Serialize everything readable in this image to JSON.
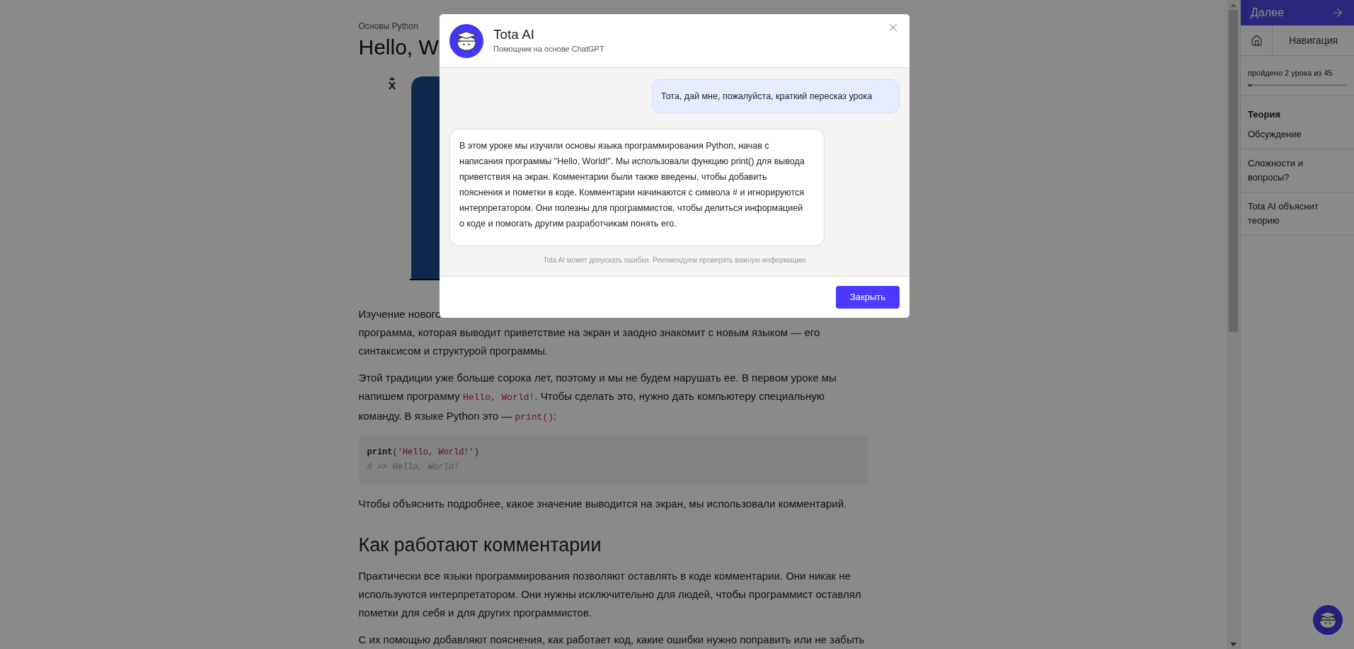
{
  "article": {
    "breadcrumb": "Основы Python",
    "title": "Hello, W",
    "blocks": [
      {
        "kind": "paragraph",
        "parts": [
          {
            "kind": "text",
            "text": "Изучение нового"
          }
        ],
        "continued": [
          {
            "kind": "text",
            "text": "программа, которая выводит приветствие на экран и заодно знакомит с новым языком — его синтаксисом и структурой программы."
          }
        ]
      },
      {
        "kind": "paragraph",
        "parts": [
          {
            "kind": "text",
            "text": "Этой традиции уже больше сорока лет, поэтому и мы не будем нарушать ее. В первом уроке мы напишем программу "
          },
          {
            "kind": "code",
            "text": "Hello, World!"
          },
          {
            "kind": "text",
            "text": ". Чтобы сделать это, нужно дать компьютеру специальную команду. В языке Python это — "
          },
          {
            "kind": "code",
            "text": "print()"
          },
          {
            "kind": "text",
            "text": ":"
          }
        ]
      },
      {
        "kind": "code_block",
        "lines": [
          [
            {
              "kind": "function",
              "text": "print"
            },
            {
              "kind": "punct",
              "text": "("
            },
            {
              "kind": "string",
              "text": "'Hello, World!'"
            },
            {
              "kind": "punct",
              "text": ")"
            }
          ],
          [
            {
              "kind": "comment",
              "text": "# => Hello, World!"
            }
          ]
        ]
      },
      {
        "kind": "paragraph",
        "parts": [
          {
            "kind": "text",
            "text": "Чтобы объяснить подробнее, какое значение выводится на экран, мы использовали комментарий."
          }
        ]
      },
      {
        "kind": "heading",
        "text": "Как работают комментарии"
      },
      {
        "kind": "paragraph",
        "parts": [
          {
            "kind": "text",
            "text": "Практически все языки программирования позволяют оставлять в коде комментарии. Они никак не используются интерпретатором. Они нужны исключительно для людей, чтобы программист оставлял пометки для себя и для других программистов."
          }
        ]
      },
      {
        "kind": "paragraph",
        "parts": [
          {
            "kind": "text",
            "text": "С их помощью добавляют пояснения, как работает код, какие ошибки нужно поправить или не забыть"
          }
        ]
      }
    ]
  },
  "sidebar": {
    "next_button": "Далее",
    "navigation": "Навигация",
    "progress": {
      "text": "пройдено 2 урока из 45",
      "level": 0.044
    },
    "groups": [
      {
        "items": [
          {
            "label": "Теория",
            "selected": true
          },
          {
            "label": "Обсуждение",
            "selected": false
          }
        ]
      },
      {
        "items": [
          {
            "label": "Сложности и вопросы?",
            "selected": false
          }
        ]
      },
      {
        "items": [
          {
            "label": "Tota AI объяснит теорию",
            "selected": false
          }
        ]
      }
    ]
  },
  "dialog": {
    "title": "Tota AI",
    "subtitle": "Помощник на основе ChatGPT",
    "messages": [
      {
        "kind": "user",
        "text": "Тота, дай мне, пожалуйста, краткий пересказ урока"
      },
      {
        "kind": "assistant",
        "text": "В этом уроке мы изучили основы языка программирования Python, начав с написания программы \"Hello, World!\". Мы использовали функцию print() для вывода приветствия на экран. Комментарии были также введены, чтобы добавить пояснения и пометки в коде. Комментарии начинаются с символа # и игнорируются интерпретатором. Они полезны для программистов, чтобы делиться информацией о коде и помогать другим разработчикам понять его."
      }
    ],
    "disclaimer": "Tota AI может допускать ошибки. Рекомендуем проверять важную информацию",
    "close_button": "Закрыть"
  }
}
